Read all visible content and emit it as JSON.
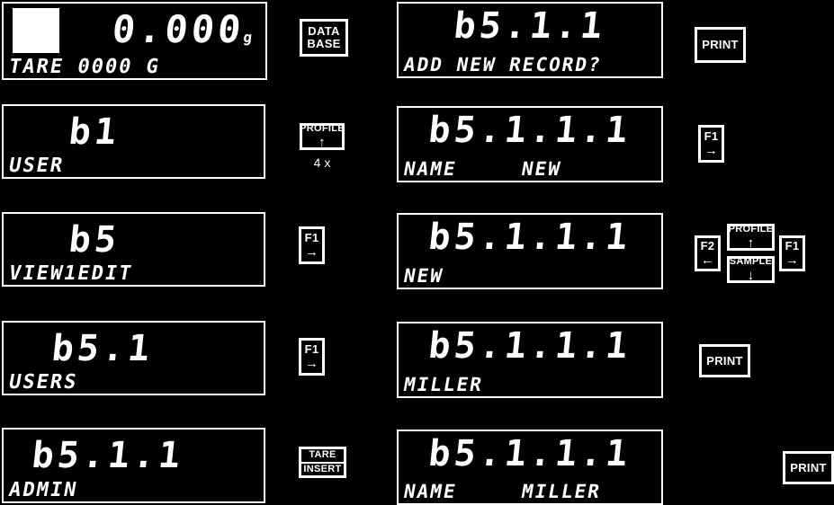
{
  "diagram": {
    "title": "Database user record creation key sequence",
    "background_color": "#000000",
    "foreground_color": "#ffffff"
  },
  "rows": [
    {
      "left_display": {
        "indicator": "tare-square-indicator",
        "main_value": "0.000",
        "unit": "g",
        "status_left": "TARE  0000   G",
        "status_right": ""
      },
      "middle_key": {
        "label_lines": [
          "DATA",
          "BASE"
        ],
        "arrow": "",
        "caption": ""
      },
      "right_display": {
        "main_value": "b5.1.1",
        "unit": "",
        "status_left": "ADD NEW RECORD?",
        "status_right": ""
      },
      "right_key": {
        "label_lines": [
          "PRINT"
        ],
        "arrow": "",
        "caption": ""
      }
    },
    {
      "left_display": {
        "indicator": "",
        "main_value": "b1",
        "unit": "",
        "status_left": "USER",
        "status_right": ""
      },
      "middle_key": {
        "label_lines": [
          "PROFILE"
        ],
        "arrow": "↑",
        "caption": "4 x"
      },
      "right_display": {
        "main_value": "b5.1.1.1",
        "unit": "",
        "status_left": "NAME",
        "status_right": "NEW"
      },
      "right_key": {
        "label_lines": [
          "F1"
        ],
        "arrow": "→",
        "caption": ""
      }
    },
    {
      "left_display": {
        "indicator": "",
        "main_value": "b5",
        "unit": "",
        "status_left": "VIEW1EDIT",
        "status_right": ""
      },
      "middle_key": {
        "label_lines": [
          "F1"
        ],
        "arrow": "→",
        "caption": ""
      },
      "right_display": {
        "main_value": "b5.1.1.1",
        "unit": "",
        "status_left": "NEW",
        "status_right": ""
      },
      "right_key": {
        "label_lines": [],
        "arrow": "",
        "caption": ""
      }
    },
    {
      "left_display": {
        "indicator": "",
        "main_value": "b5.1",
        "unit": "",
        "status_left": "USERS",
        "status_right": ""
      },
      "middle_key": {
        "label_lines": [
          "F1"
        ],
        "arrow": "→",
        "caption": ""
      },
      "right_display": {
        "main_value": "b5.1.1.1",
        "unit": "",
        "status_left": "MILLER",
        "status_right": ""
      },
      "right_key": {
        "label_lines": [
          "PRINT"
        ],
        "arrow": "",
        "caption": ""
      }
    },
    {
      "left_display": {
        "indicator": "",
        "main_value": "b5.1.1",
        "unit": "",
        "status_left": "ADMIN",
        "status_right": ""
      },
      "middle_key": {
        "label_lines": [
          "TARE",
          "INSERT"
        ],
        "arrow": "",
        "caption": ""
      },
      "right_display": {
        "main_value": "b5.1.1.1",
        "unit": "",
        "status_left": "NAME",
        "status_right": "MILLER"
      },
      "right_key": {
        "label_lines": [
          "PRINT"
        ],
        "arrow": "",
        "caption": ""
      }
    }
  ],
  "nav_cluster": {
    "left_key": {
      "label": "F2",
      "arrow": "←"
    },
    "up_key": {
      "label": "PROFILE",
      "arrow": "↑"
    },
    "down_key": {
      "label": "SAMPLE",
      "arrow": "↓"
    },
    "right_key": {
      "label": "F1",
      "arrow": "→"
    }
  }
}
